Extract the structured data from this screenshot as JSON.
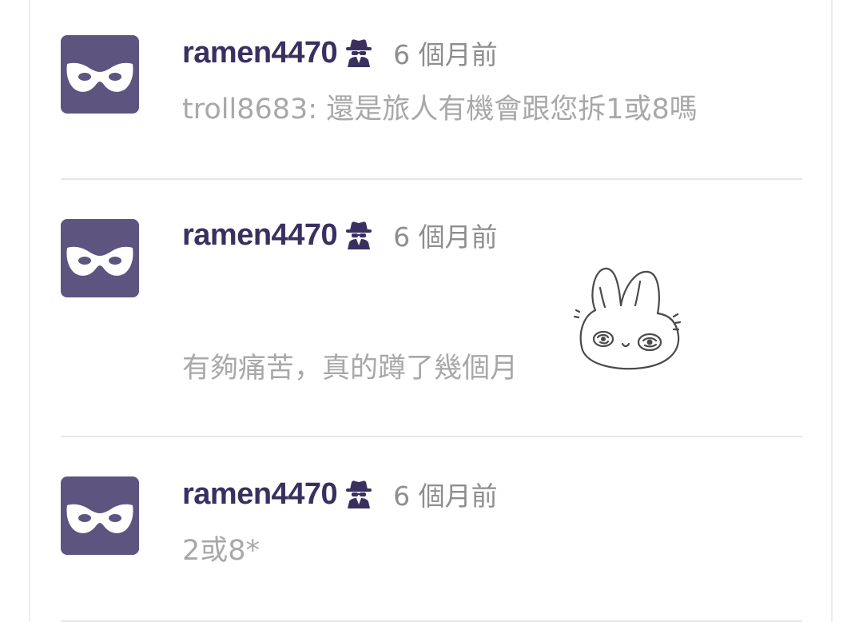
{
  "comments": [
    {
      "username": "ramen4470",
      "badge_icon": "spy-icon",
      "time": "6 個月前",
      "text": "troll8683: 還是旅人有機會跟您拆1或8嗎",
      "avatar_icon": "mask-icon"
    },
    {
      "username": "ramen4470",
      "badge_icon": "spy-icon",
      "time": "6 個月前",
      "text": "有夠痛苦，真的蹲了幾個月",
      "avatar_icon": "mask-icon",
      "sticker_icon": "bunny-sticker"
    },
    {
      "username": "ramen4470",
      "badge_icon": "spy-icon",
      "time": "6 個月前",
      "text": "2或8*",
      "avatar_icon": "mask-icon"
    }
  ],
  "colors": {
    "avatar_bg": "#5d5480",
    "username": "#3a3060",
    "timestamp": "#8e8e8e",
    "body_text": "#a8a8a8",
    "divider": "#e6e6e6"
  }
}
